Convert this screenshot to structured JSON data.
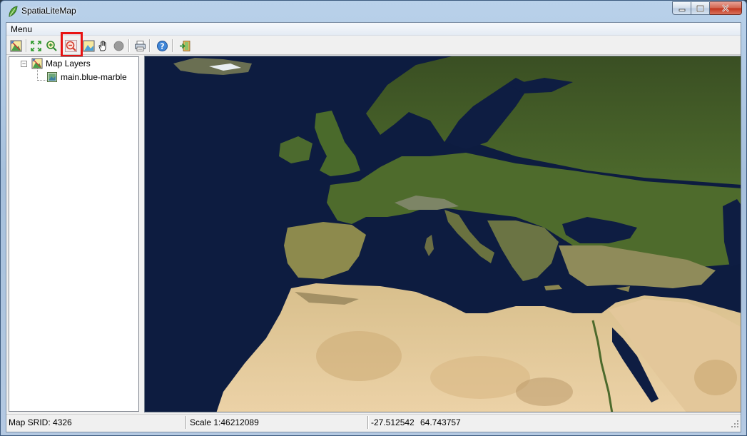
{
  "window": {
    "title": "SpatiaLiteMap",
    "controls": {
      "minimize": "minimize",
      "maximize": "maximize",
      "close": "close"
    }
  },
  "menubar": {
    "items": [
      {
        "label": "Menu"
      }
    ]
  },
  "toolbar": {
    "buttons": [
      {
        "name": "layers-icon"
      },
      {
        "name": "zoom-extent-icon"
      },
      {
        "name": "zoom-in-icon"
      },
      {
        "name": "zoom-out-icon",
        "highlighted": true
      },
      {
        "name": "zoom-layer-icon"
      },
      {
        "name": "pan-hand-icon"
      },
      {
        "name": "stop-icon"
      },
      {
        "name": "print-icon"
      },
      {
        "name": "help-icon"
      },
      {
        "name": "exit-icon"
      }
    ],
    "highlight_color": "#e81212"
  },
  "tree": {
    "root": {
      "label": "Map Layers",
      "expander": "⊟"
    },
    "layers": [
      {
        "label": "main.blue-marble"
      }
    ]
  },
  "map": {
    "layer": "main.blue-marble",
    "ocean_color": "#0b1a3b"
  },
  "statusbar": {
    "srid": "Map SRID: 4326",
    "scale": "Scale 1:46212089",
    "coord_x": "-27.512542",
    "coord_y": "64.743757"
  }
}
